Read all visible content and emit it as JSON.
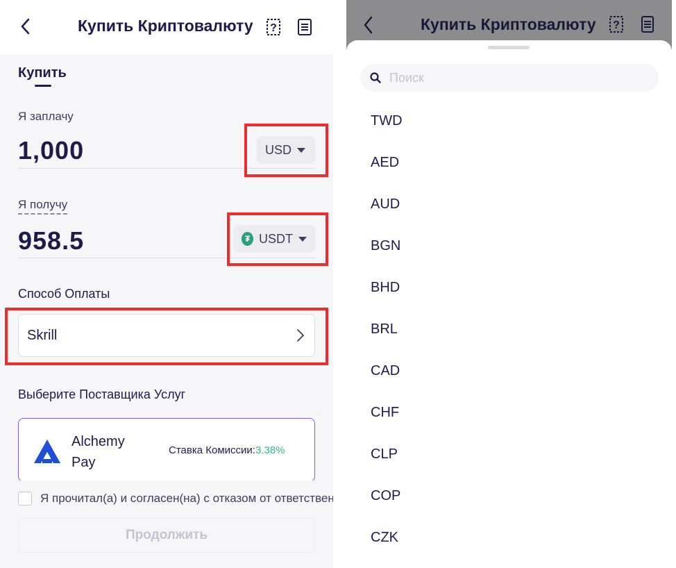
{
  "left": {
    "header": {
      "title": "Купить Криптовалюту"
    },
    "tab": {
      "label": "Купить"
    },
    "pay": {
      "label": "Я заплачу",
      "amount": "1,000",
      "currency": "USD"
    },
    "receive": {
      "label": "Я получу",
      "amount": "958.5",
      "currency": "USDT",
      "currency_icon": "tether-icon"
    },
    "payment_method": {
      "label": "Способ Оплаты",
      "value": "Skrill"
    },
    "provider": {
      "section_label": "Выберите Поставщика Услуг",
      "name": "Alchemy Pay",
      "fee_label": "Ставка Комиссии:",
      "fee_value": "3.38%"
    },
    "agreement": {
      "text": "Я прочитал(а) и согласен(на) с отказом от ответственности"
    },
    "continue_label": "Продолжить"
  },
  "right": {
    "header": {
      "title": "Купить Криптовалюту"
    },
    "search": {
      "placeholder": "Поиск"
    },
    "currencies": [
      "TWD",
      "AED",
      "AUD",
      "BGN",
      "BHD",
      "BRL",
      "CAD",
      "CHF",
      "CLP",
      "COP",
      "CZK"
    ]
  },
  "colors": {
    "primary_text": "#1e1b4b",
    "accent_green": "#2ebd85",
    "highlight_red": "#ef2b2b",
    "provider_border": "#7c5ce6",
    "tether_green": "#26a17b"
  }
}
